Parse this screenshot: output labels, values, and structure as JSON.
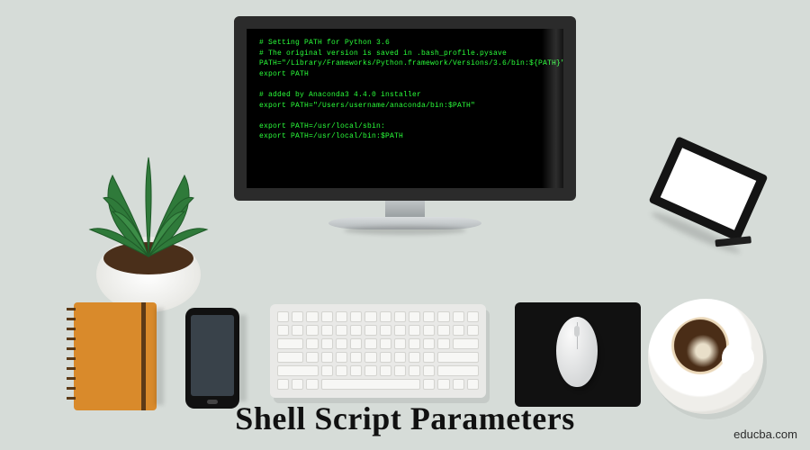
{
  "title": "Shell Script Parameters",
  "watermark": "educba.com",
  "screen": {
    "lines": [
      "# Setting PATH for Python 3.6",
      "# The original version is saved in .bash_profile.pysave",
      "PATH=\"/Library/Frameworks/Python.framework/Versions/3.6/bin:${PATH}\"",
      "export PATH",
      "",
      "# added by Anaconda3 4.4.0 installer",
      "export PATH=\"/Users/username/anaconda/bin:$PATH\"",
      "",
      "export PATH=/usr/local/sbin:",
      "export PATH=/usr/local/bin:$PATH"
    ]
  },
  "colors": {
    "background": "#d6dcd8",
    "terminal_green": "#2aff3a",
    "notebook": "#d98a2b"
  }
}
